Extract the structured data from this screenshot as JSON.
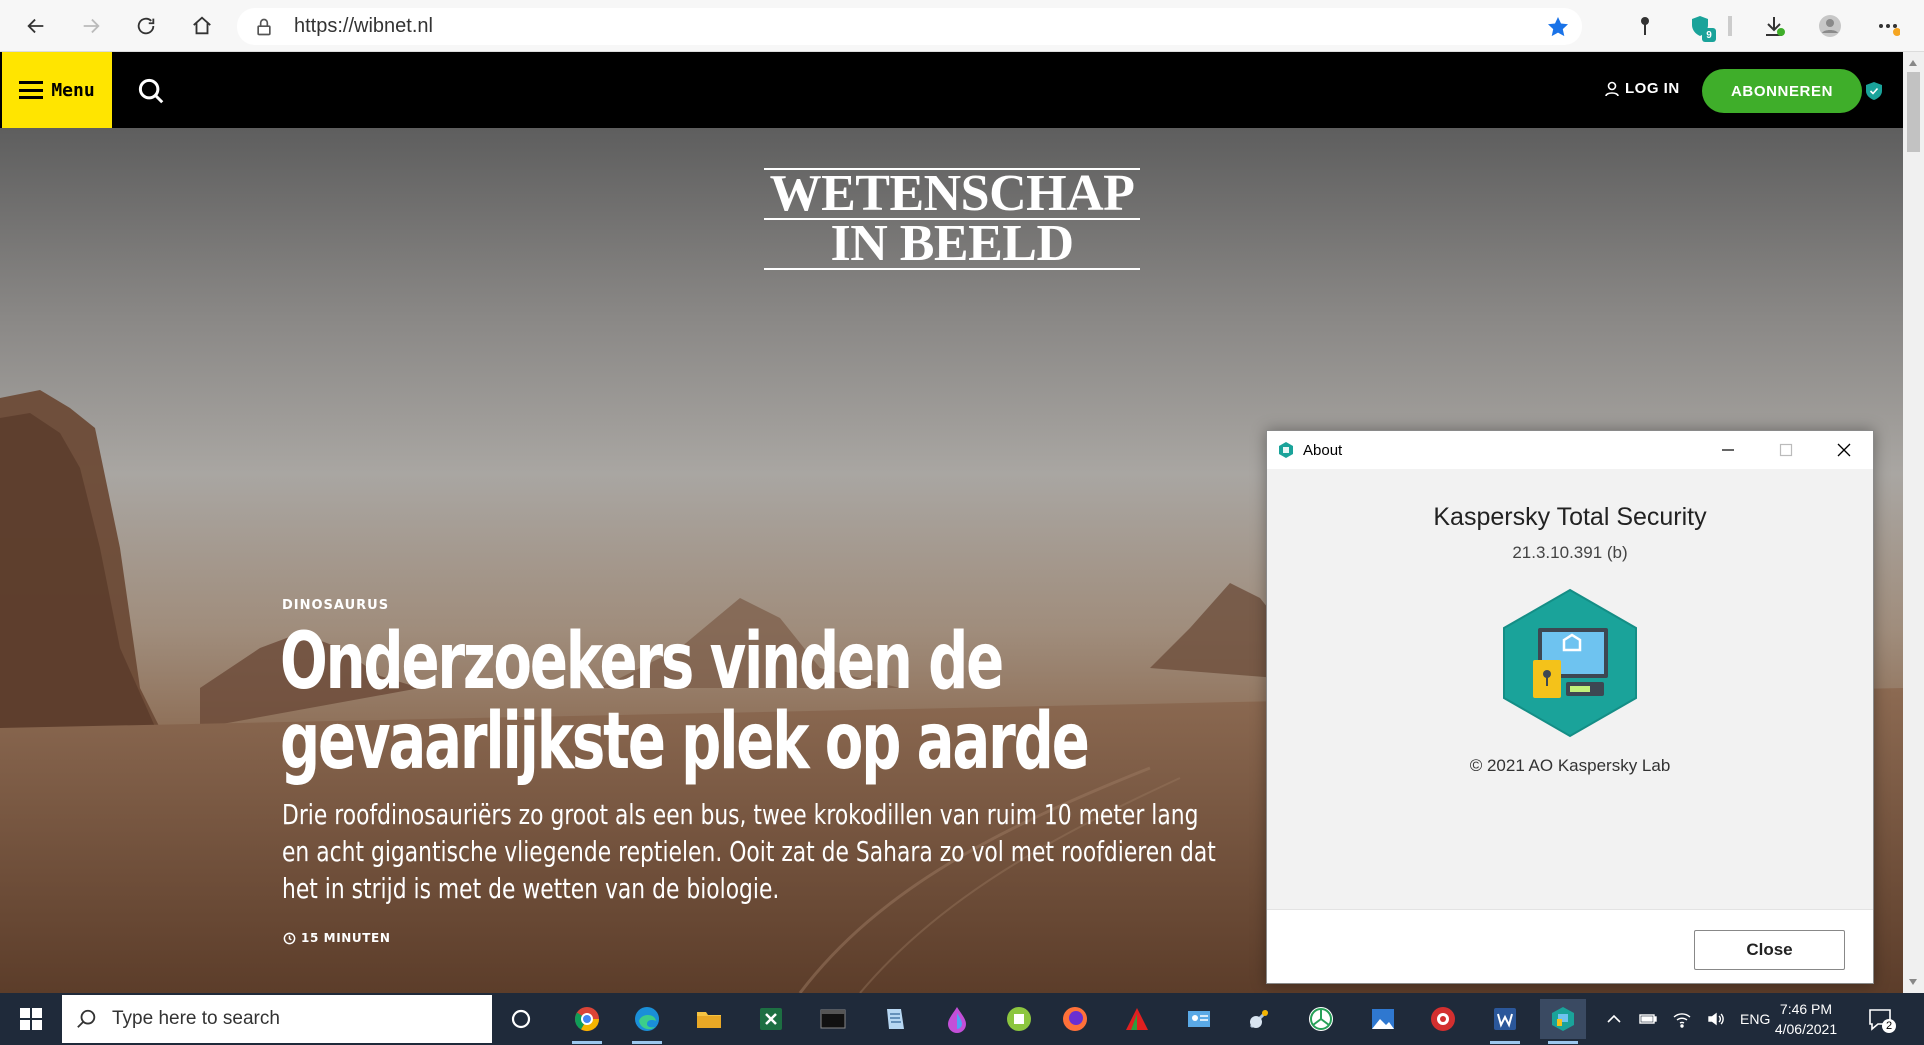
{
  "browser": {
    "url": "https://wibnet.nl",
    "extension_badge_count": "9"
  },
  "site": {
    "menu_label": "Menu",
    "login_label": "LOG IN",
    "subscribe_label": "ABONNEREN",
    "logo_line1": "WETENSCHAP",
    "logo_line2": "IN BEELD"
  },
  "article": {
    "kicker": "DINOSAURUS",
    "headline_line1": "Onderzoekers vinden de",
    "headline_line2": "gevaarlijkste plek op aarde",
    "dek_line1": "Drie roofdinosauriërs zo groot als een bus, twee krokodillen van ruim 10 meter lang",
    "dek_line2": "en acht gigantische vliegende reptielen. Ooit zat de Sahara zo vol met roofdieren dat",
    "dek_line3": "het in strijd is met de wetten van de biologie.",
    "read_time": "15 MINUTEN"
  },
  "dialog": {
    "title": "About",
    "product_name": "Kaspersky Total Security",
    "version": "21.3.10.391 (b)",
    "copyright": "© 2021 AO Kaspersky Lab",
    "close_label": "Close"
  },
  "taskbar": {
    "search_placeholder": "Type here to search",
    "language": "ENG",
    "time": "7:46 PM",
    "date": "4/06/2021",
    "notification_count": "2"
  },
  "colors": {
    "menu_yellow": "#ffe500",
    "subscribe_green": "#3fae2a",
    "kaspersky_teal": "#1aa39a",
    "taskbar": "#1f2a3a"
  }
}
